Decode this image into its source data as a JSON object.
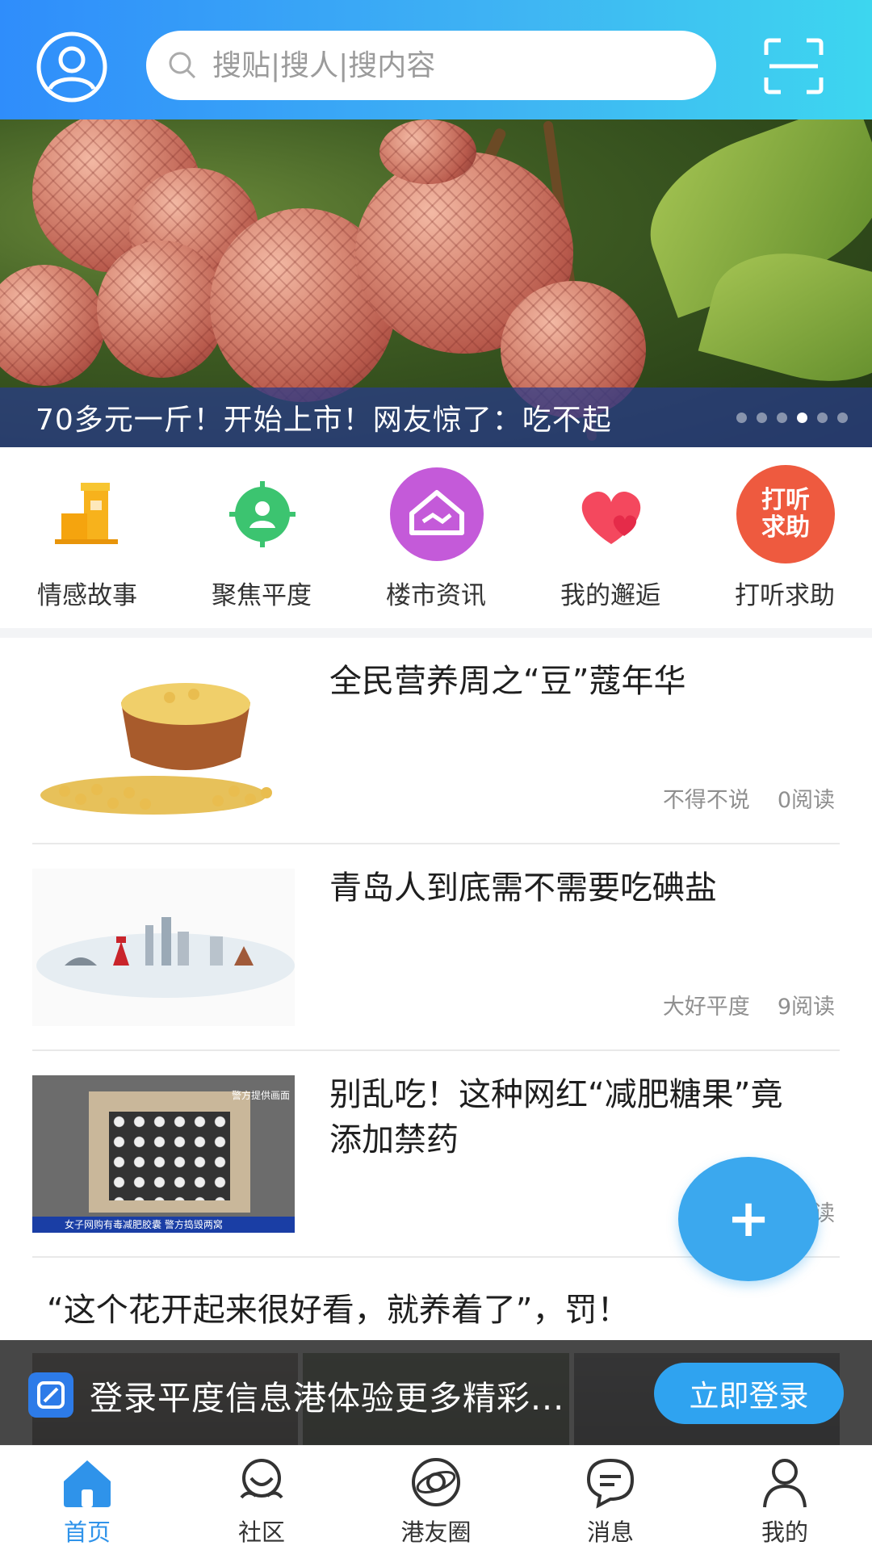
{
  "header": {
    "search_placeholder": "搜贴|搜人|搜内容",
    "avatar_icon": "user-circle-icon",
    "scan_icon": "scan-icon"
  },
  "banner": {
    "caption": "70多元一斤！开始上市！网友惊了：吃不起",
    "dot_count": 6,
    "active_dot": 4
  },
  "quick_nav": [
    {
      "label": "情感故事",
      "icon": "building-icon"
    },
    {
      "label": "聚焦平度",
      "icon": "target-person-icon"
    },
    {
      "label": "楼市资讯",
      "icon": "house-handshake-icon"
    },
    {
      "label": "我的邂逅",
      "icon": "hearts-icon"
    },
    {
      "label": "打听求助",
      "icon": "ask-help-badge-icon",
      "badge_text": "打听求助"
    }
  ],
  "articles": [
    {
      "title": "全民营养周之“豆”蔻年华",
      "source": "不得不说",
      "reads": "0阅读"
    },
    {
      "title": "青岛人到底需不需要吃碘盐",
      "source": "大好平度",
      "reads": "9阅读"
    },
    {
      "title": "别乱吃！这种网红“减肥糖果”竟添加禁药",
      "source": "平",
      "reads": "读",
      "thumb_caption": "女子网购有毒减肥胶囊 警方捣毁两窝",
      "thumb_tag": "警方提供画面"
    },
    {
      "title": "“这个花开起来很好看，就养着了”，罚！"
    }
  ],
  "fab": {
    "label": "+"
  },
  "login_bar": {
    "text": "登录平度信息港体验更多精彩...",
    "button": "立即登录"
  },
  "tabbar": [
    {
      "label": "首页",
      "icon": "home-icon",
      "active": true
    },
    {
      "label": "社区",
      "icon": "community-icon",
      "active": false
    },
    {
      "label": "港友圈",
      "icon": "planet-icon",
      "active": false
    },
    {
      "label": "消息",
      "icon": "message-icon",
      "active": false
    },
    {
      "label": "我的",
      "icon": "profile-icon",
      "active": false
    }
  ],
  "colors": {
    "header_gradient_start": "#2f8dfb",
    "header_gradient_end": "#3dd6ef",
    "accent": "#2f93ea",
    "fab": "#3ba8ee"
  }
}
